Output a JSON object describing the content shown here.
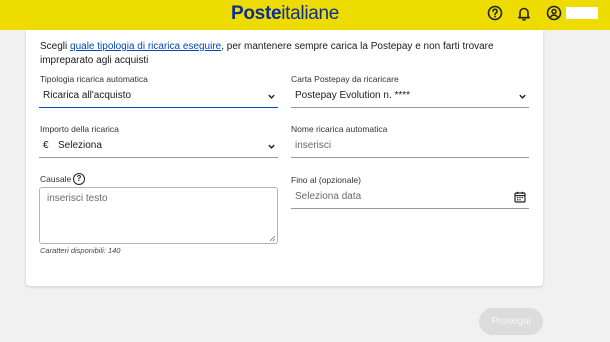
{
  "header": {
    "logo_bold": "Poste",
    "logo_regular": "italiane",
    "icons": [
      "help-icon",
      "bell-icon",
      "user-icon"
    ],
    "brand_color": "#eedc00",
    "logo_color": "#0c2f8f"
  },
  "intro": {
    "prefix": "Scegli ",
    "link": "quale tipologia di ricarica eseguire",
    "suffix": ", per mantenere sempre carica la Postepay e non farti trovare impreparato agli acquisti"
  },
  "form": {
    "tipologia": {
      "label": "Tipologia ricarica automatica",
      "value": "Ricarica all'acquisto"
    },
    "carta": {
      "label": "Carta Postepay da ricaricare",
      "value": "Postepay Evolution n. ****"
    },
    "importo": {
      "label": "Importo della ricarica",
      "currency": "€",
      "value": "Seleziona"
    },
    "nome": {
      "label": "Nome ricarica automatica",
      "placeholder": "inserisci"
    },
    "causale": {
      "label": "Causale",
      "help": "?",
      "placeholder": "inserisci testo",
      "hint": "Caratteri disponibili: 140"
    },
    "fino_al": {
      "label": "Fino al (opzionale)",
      "placeholder": "Seleziona data"
    }
  },
  "actions": {
    "submit": "Prosegui"
  },
  "colors": {
    "accent": "#0047bb",
    "disabled_button": "#dcdcdc"
  }
}
